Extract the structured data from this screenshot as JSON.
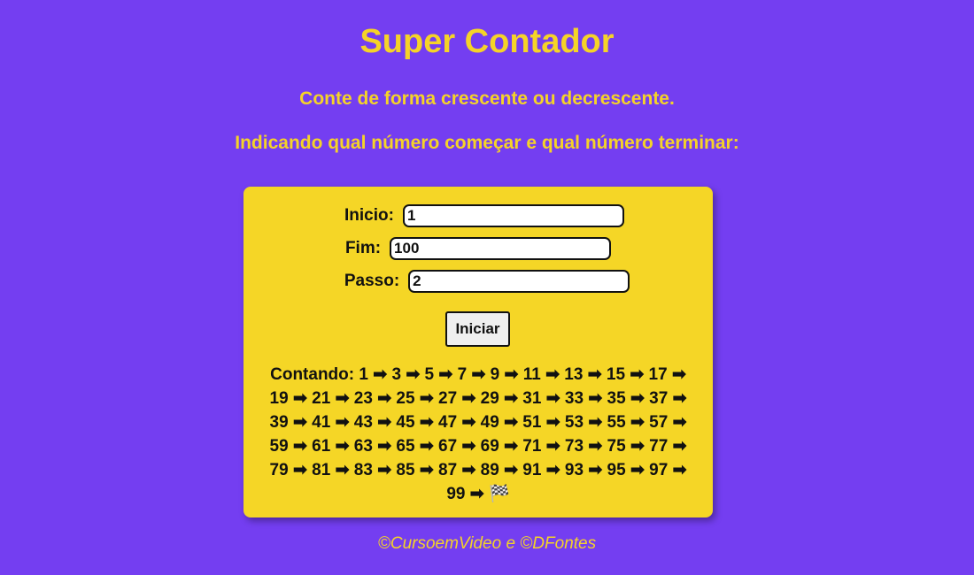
{
  "page": {
    "title": "Super Contador",
    "subtitle_1": "Conte de forma crescente ou decrescente.",
    "subtitle_2": "Indicando qual número começar e qual número terminar:",
    "footer": "©CursoemVideo e ©DFontes"
  },
  "form": {
    "inicio_label": "Inicio:",
    "inicio_value": "1",
    "fim_label": "Fim:",
    "fim_value": "100",
    "passo_label": "Passo:",
    "passo_value": "2",
    "button_label": "Iniciar"
  },
  "result": {
    "prefix": "Contando:",
    "numbers": [
      1,
      3,
      5,
      7,
      9,
      11,
      13,
      15,
      17,
      19,
      21,
      23,
      25,
      27,
      29,
      31,
      33,
      35,
      37,
      39,
      41,
      43,
      45,
      47,
      49,
      51,
      53,
      55,
      57,
      59,
      61,
      63,
      65,
      67,
      69,
      71,
      73,
      75,
      77,
      79,
      81,
      83,
      85,
      87,
      89,
      91,
      93,
      95,
      97,
      99
    ],
    "separator": "➡",
    "end_icon": "🏁"
  },
  "colors": {
    "background": "#743ef1",
    "accent": "#f5d328",
    "card": "#f5d626"
  },
  "icons": {
    "arrow": "right-arrow-icon",
    "end": "checkered-flag-icon"
  }
}
